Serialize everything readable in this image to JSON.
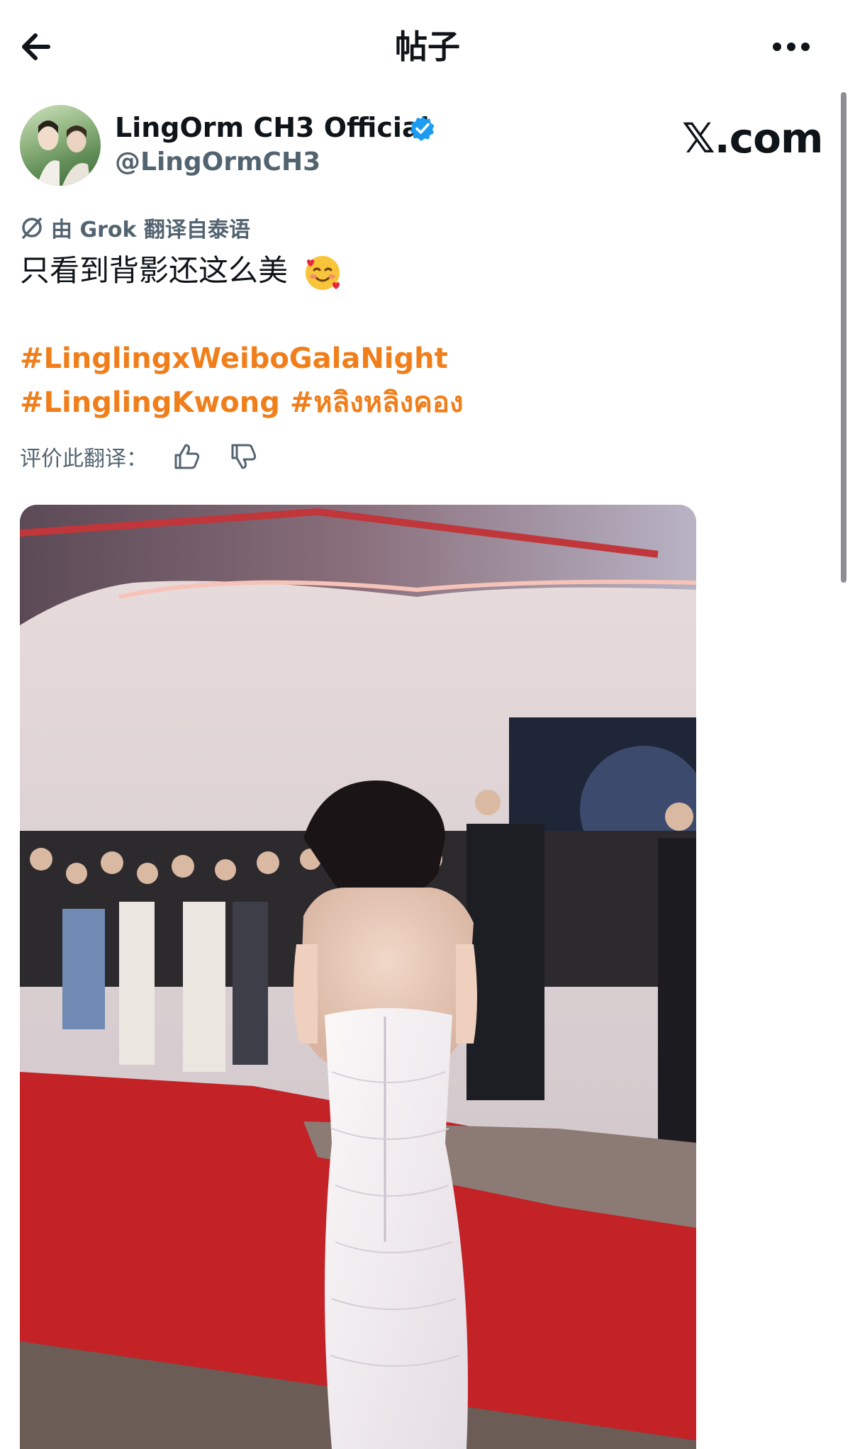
{
  "header": {
    "title": "帖子",
    "back_icon": "arrow-left-icon",
    "more_icon": "more-horizontal-icon"
  },
  "author": {
    "display_name": "LingOrm CH3 Official",
    "handle": "@LingOrmCH3",
    "verified": true,
    "verified_color": "#1d9bf0"
  },
  "watermark": "𝕏.com",
  "translation": {
    "note": "由 Grok 翻译自泰语",
    "icon": "grok-icon"
  },
  "post": {
    "text": "只看到背影还这么美",
    "emoji": "smiling-face-with-hearts",
    "hashtags": {
      "line1": "#LinglingxWeiboGalaNight",
      "line2": "#LinglingKwong #หลิงหลิงคอง"
    },
    "hashtag_color": "#f07f1b"
  },
  "rating": {
    "label": "评价此翻译：",
    "thumbs_up_icon": "thumbs-up-icon",
    "thumbs_down_icon": "thumbs-down-icon"
  },
  "media": {
    "type": "photo"
  }
}
